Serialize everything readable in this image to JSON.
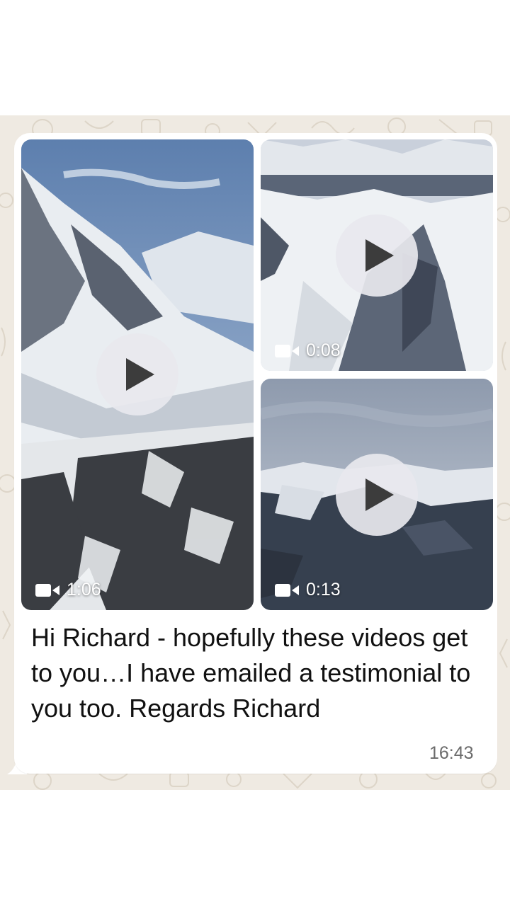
{
  "message": {
    "text": "Hi Richard - hopefully these videos get to you…I have emailed a testimonial to you too. Regards Richard",
    "time": "16:43"
  },
  "videos": [
    {
      "duration": "1:06",
      "icon": "video-camera-icon"
    },
    {
      "duration": "0:08",
      "icon": "video-camera-icon"
    },
    {
      "duration": "0:13",
      "icon": "video-camera-icon"
    }
  ],
  "colors": {
    "chat_background": "#efeae2",
    "bubble": "#ffffff",
    "timestamp": "#6b6b6b"
  }
}
